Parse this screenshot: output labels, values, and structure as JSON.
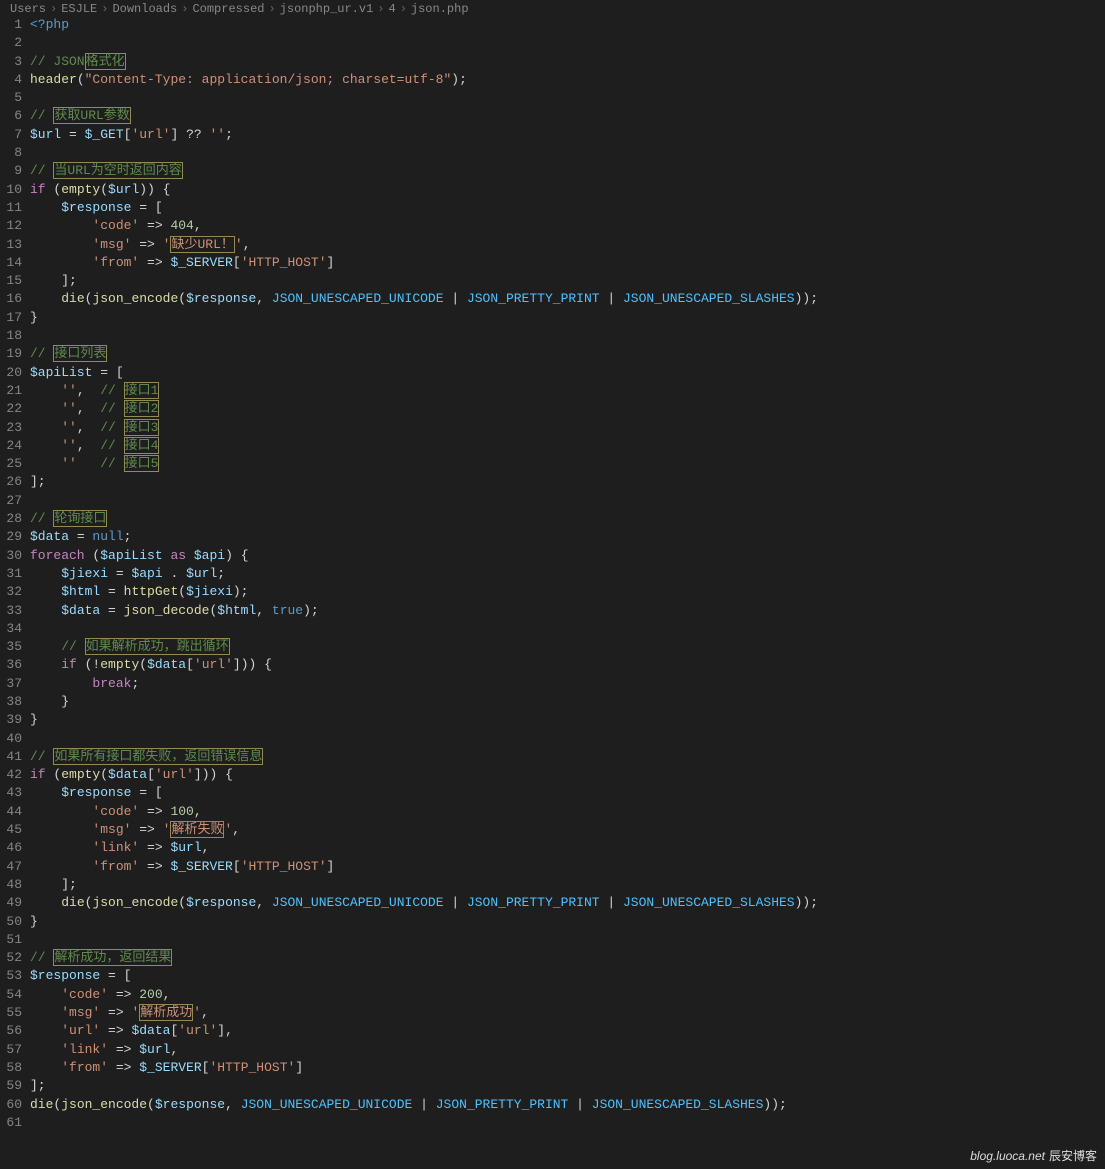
{
  "breadcrumb": [
    "Users",
    "ESJLE",
    "Downloads",
    "Compressed",
    "jsonphp_ur.v1",
    "4",
    "json.php"
  ],
  "gutterStart": 1,
  "gutterEnd": 61,
  "watermark": {
    "url": "blog.luoca.net",
    "label": "辰安博客"
  },
  "lines": [
    [
      [
        "tag",
        "<?php"
      ]
    ],
    [],
    [
      [
        "c",
        "// JSON"
      ],
      [
        "c box",
        "格式化"
      ]
    ],
    [
      [
        "fn",
        "header"
      ],
      [
        "p",
        "("
      ],
      [
        "s",
        "\"Content-Type: application/json; charset=utf-8\""
      ],
      [
        "p",
        ");"
      ]
    ],
    [],
    [
      [
        "c",
        "// "
      ],
      [
        "c box",
        "获取URL参数"
      ]
    ],
    [
      [
        "v",
        "$url"
      ],
      [
        "p",
        " = "
      ],
      [
        "v",
        "$_GET"
      ],
      [
        "p",
        "["
      ],
      [
        "s",
        "'url'"
      ],
      [
        "p",
        "] ?? "
      ],
      [
        "s",
        "''"
      ],
      [
        "p",
        ";"
      ]
    ],
    [],
    [
      [
        "c",
        "// "
      ],
      [
        "c box",
        "当URL为空时返回内容"
      ]
    ],
    [
      [
        "k",
        "if"
      ],
      [
        "p",
        " ("
      ],
      [
        "fn",
        "empty"
      ],
      [
        "p",
        "("
      ],
      [
        "v",
        "$url"
      ],
      [
        "p",
        ")) {"
      ]
    ],
    [
      [
        "p",
        "    "
      ],
      [
        "v",
        "$response"
      ],
      [
        "p",
        " = ["
      ]
    ],
    [
      [
        "p",
        "        "
      ],
      [
        "s",
        "'code'"
      ],
      [
        "p",
        " => "
      ],
      [
        "n",
        "404"
      ],
      [
        "p",
        ","
      ]
    ],
    [
      [
        "p",
        "        "
      ],
      [
        "s",
        "'msg'"
      ],
      [
        "p",
        " => "
      ],
      [
        "s",
        "'"
      ],
      [
        "s box",
        "缺少URL！"
      ],
      [
        "s",
        "'"
      ],
      [
        "p",
        ","
      ]
    ],
    [
      [
        "p",
        "        "
      ],
      [
        "s",
        "'from'"
      ],
      [
        "p",
        " => "
      ],
      [
        "v",
        "$_SERVER"
      ],
      [
        "p",
        "["
      ],
      [
        "s",
        "'HTTP_HOST'"
      ],
      [
        "p",
        "]"
      ]
    ],
    [
      [
        "p",
        "    ];"
      ]
    ],
    [
      [
        "p",
        "    "
      ],
      [
        "fn",
        "die"
      ],
      [
        "p",
        "("
      ],
      [
        "fn",
        "json_encode"
      ],
      [
        "p",
        "("
      ],
      [
        "v",
        "$response"
      ],
      [
        "p",
        ", "
      ],
      [
        "const",
        "JSON_UNESCAPED_UNICODE"
      ],
      [
        "p",
        " | "
      ],
      [
        "const",
        "JSON_PRETTY_PRINT"
      ],
      [
        "p",
        " | "
      ],
      [
        "const",
        "JSON_UNESCAPED_SLASHES"
      ],
      [
        "p",
        "));"
      ]
    ],
    [
      [
        "p",
        "}"
      ]
    ],
    [],
    [
      [
        "c",
        "// "
      ],
      [
        "c box",
        "接口列表"
      ]
    ],
    [
      [
        "v",
        "$apiList"
      ],
      [
        "p",
        " = ["
      ]
    ],
    [
      [
        "p",
        "    "
      ],
      [
        "s",
        "''"
      ],
      [
        "p",
        ",  "
      ],
      [
        "c",
        "// "
      ],
      [
        "c box",
        "接口1"
      ]
    ],
    [
      [
        "p",
        "    "
      ],
      [
        "s",
        "''"
      ],
      [
        "p",
        ",  "
      ],
      [
        "c",
        "// "
      ],
      [
        "c box",
        "接口2"
      ]
    ],
    [
      [
        "p",
        "    "
      ],
      [
        "s",
        "''"
      ],
      [
        "p",
        ",  "
      ],
      [
        "c",
        "// "
      ],
      [
        "c box",
        "接口3"
      ]
    ],
    [
      [
        "p",
        "    "
      ],
      [
        "s",
        "''"
      ],
      [
        "p",
        ",  "
      ],
      [
        "c",
        "// "
      ],
      [
        "c box",
        "接口4"
      ]
    ],
    [
      [
        "p",
        "    "
      ],
      [
        "s",
        "''"
      ],
      [
        "p",
        "   "
      ],
      [
        "c",
        "// "
      ],
      [
        "c box",
        "接口5"
      ]
    ],
    [
      [
        "p",
        "];"
      ]
    ],
    [],
    [
      [
        "c",
        "// "
      ],
      [
        "c box",
        "轮询接口"
      ]
    ],
    [
      [
        "v",
        "$data"
      ],
      [
        "p",
        " = "
      ],
      [
        "bl",
        "null"
      ],
      [
        "p",
        ";"
      ]
    ],
    [
      [
        "k",
        "foreach"
      ],
      [
        "p",
        " ("
      ],
      [
        "v",
        "$apiList"
      ],
      [
        "p",
        " "
      ],
      [
        "k",
        "as"
      ],
      [
        "p",
        " "
      ],
      [
        "v",
        "$api"
      ],
      [
        "p",
        ") {"
      ]
    ],
    [
      [
        "p",
        "    "
      ],
      [
        "v",
        "$jiexi"
      ],
      [
        "p",
        " = "
      ],
      [
        "v",
        "$api"
      ],
      [
        "p",
        " . "
      ],
      [
        "v",
        "$url"
      ],
      [
        "p",
        ";"
      ]
    ],
    [
      [
        "p",
        "    "
      ],
      [
        "v",
        "$html"
      ],
      [
        "p",
        " = "
      ],
      [
        "fn",
        "httpGet"
      ],
      [
        "p",
        "("
      ],
      [
        "v",
        "$jiexi"
      ],
      [
        "p",
        ");"
      ]
    ],
    [
      [
        "p",
        "    "
      ],
      [
        "v",
        "$data"
      ],
      [
        "p",
        " = "
      ],
      [
        "fn",
        "json_decode"
      ],
      [
        "p",
        "("
      ],
      [
        "v",
        "$html"
      ],
      [
        "p",
        ", "
      ],
      [
        "bl",
        "true"
      ],
      [
        "p",
        ");"
      ]
    ],
    [],
    [
      [
        "p",
        "    "
      ],
      [
        "c",
        "// "
      ],
      [
        "c box",
        "如果解析成功，跳出循环"
      ]
    ],
    [
      [
        "p",
        "    "
      ],
      [
        "k",
        "if"
      ],
      [
        "p",
        " (!"
      ],
      [
        "fn",
        "empty"
      ],
      [
        "p",
        "("
      ],
      [
        "v",
        "$data"
      ],
      [
        "p",
        "["
      ],
      [
        "s",
        "'url'"
      ],
      [
        "p",
        "])) {"
      ]
    ],
    [
      [
        "p",
        "        "
      ],
      [
        "k",
        "break"
      ],
      [
        "p",
        ";"
      ]
    ],
    [
      [
        "p",
        "    }"
      ]
    ],
    [
      [
        "p",
        "}"
      ]
    ],
    [],
    [
      [
        "c",
        "// "
      ],
      [
        "c box",
        "如果所有接口都失败，返回错误信息"
      ]
    ],
    [
      [
        "k",
        "if"
      ],
      [
        "p",
        " ("
      ],
      [
        "fn",
        "empty"
      ],
      [
        "p",
        "("
      ],
      [
        "v",
        "$data"
      ],
      [
        "p",
        "["
      ],
      [
        "s",
        "'url'"
      ],
      [
        "p",
        "])) {"
      ]
    ],
    [
      [
        "p",
        "    "
      ],
      [
        "v",
        "$response"
      ],
      [
        "p",
        " = ["
      ]
    ],
    [
      [
        "p",
        "        "
      ],
      [
        "s",
        "'code'"
      ],
      [
        "p",
        " => "
      ],
      [
        "n",
        "100"
      ],
      [
        "p",
        ","
      ]
    ],
    [
      [
        "p",
        "        "
      ],
      [
        "s",
        "'msg'"
      ],
      [
        "p",
        " => "
      ],
      [
        "s",
        "'"
      ],
      [
        "s box",
        "解析失败"
      ],
      [
        "s",
        "'"
      ],
      [
        "p",
        ","
      ]
    ],
    [
      [
        "p",
        "        "
      ],
      [
        "s",
        "'link'"
      ],
      [
        "p",
        " => "
      ],
      [
        "v",
        "$url"
      ],
      [
        "p",
        ","
      ]
    ],
    [
      [
        "p",
        "        "
      ],
      [
        "s",
        "'from'"
      ],
      [
        "p",
        " => "
      ],
      [
        "v",
        "$_SERVER"
      ],
      [
        "p",
        "["
      ],
      [
        "s",
        "'HTTP_HOST'"
      ],
      [
        "p",
        "]"
      ]
    ],
    [
      [
        "p",
        "    ];"
      ]
    ],
    [
      [
        "p",
        "    "
      ],
      [
        "fn",
        "die"
      ],
      [
        "p",
        "("
      ],
      [
        "fn",
        "json_encode"
      ],
      [
        "p",
        "("
      ],
      [
        "v",
        "$response"
      ],
      [
        "p",
        ", "
      ],
      [
        "const",
        "JSON_UNESCAPED_UNICODE"
      ],
      [
        "p",
        " | "
      ],
      [
        "const",
        "JSON_PRETTY_PRINT"
      ],
      [
        "p",
        " | "
      ],
      [
        "const",
        "JSON_UNESCAPED_SLASHES"
      ],
      [
        "p",
        "));"
      ]
    ],
    [
      [
        "p",
        "}"
      ]
    ],
    [],
    [
      [
        "c",
        "// "
      ],
      [
        "c box",
        "解析成功，返回结果"
      ]
    ],
    [
      [
        "v",
        "$response"
      ],
      [
        "p",
        " = ["
      ]
    ],
    [
      [
        "p",
        "    "
      ],
      [
        "s",
        "'code'"
      ],
      [
        "p",
        " => "
      ],
      [
        "n",
        "200"
      ],
      [
        "p",
        ","
      ]
    ],
    [
      [
        "p",
        "    "
      ],
      [
        "s",
        "'msg'"
      ],
      [
        "p",
        " => "
      ],
      [
        "s",
        "'"
      ],
      [
        "s box",
        "解析成功"
      ],
      [
        "s",
        "'"
      ],
      [
        "p",
        ","
      ]
    ],
    [
      [
        "p",
        "    "
      ],
      [
        "s",
        "'url'"
      ],
      [
        "p",
        " => "
      ],
      [
        "v",
        "$data"
      ],
      [
        "p",
        "["
      ],
      [
        "s",
        "'url'"
      ],
      [
        "p",
        "],"
      ]
    ],
    [
      [
        "p",
        "    "
      ],
      [
        "s",
        "'link'"
      ],
      [
        "p",
        " => "
      ],
      [
        "v",
        "$url"
      ],
      [
        "p",
        ","
      ]
    ],
    [
      [
        "p",
        "    "
      ],
      [
        "s",
        "'from'"
      ],
      [
        "p",
        " => "
      ],
      [
        "v",
        "$_SERVER"
      ],
      [
        "p",
        "["
      ],
      [
        "s",
        "'HTTP_HOST'"
      ],
      [
        "p",
        "]"
      ]
    ],
    [
      [
        "p",
        "];"
      ]
    ],
    [
      [
        "fn",
        "die"
      ],
      [
        "p",
        "("
      ],
      [
        "fn",
        "json_encode"
      ],
      [
        "p",
        "("
      ],
      [
        "v",
        "$response"
      ],
      [
        "p",
        ", "
      ],
      [
        "const",
        "JSON_UNESCAPED_UNICODE"
      ],
      [
        "p",
        " | "
      ],
      [
        "const",
        "JSON_PRETTY_PRINT"
      ],
      [
        "p",
        " | "
      ],
      [
        "const",
        "JSON_UNESCAPED_SLASHES"
      ],
      [
        "p",
        "));"
      ]
    ],
    []
  ]
}
